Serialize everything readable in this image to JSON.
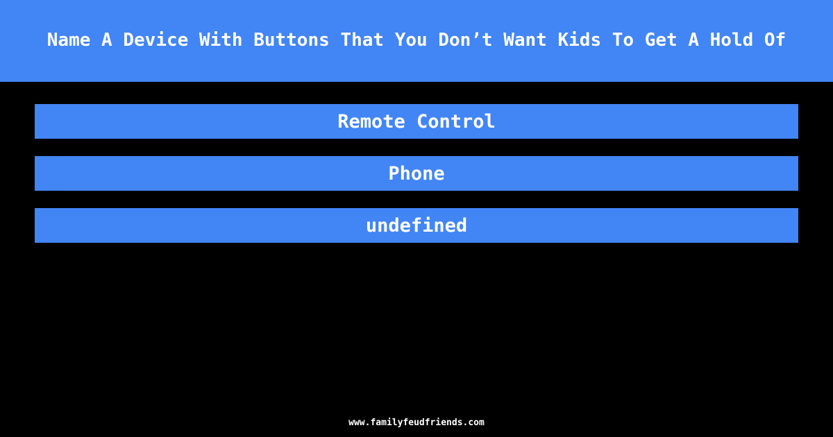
{
  "colors": {
    "background": "#000000",
    "accent": "#4285f4",
    "text_on_accent": "#ffffff",
    "footer_text": "#ffffff"
  },
  "header": {
    "question": "Name A Device With Buttons That You Don’t Want Kids To Get A Hold Of"
  },
  "answers": {
    "items": [
      {
        "label": "Remote Control"
      },
      {
        "label": "Phone"
      },
      {
        "label": "undefined"
      }
    ]
  },
  "footer": {
    "site": "www.familyfeudfriends.com"
  }
}
